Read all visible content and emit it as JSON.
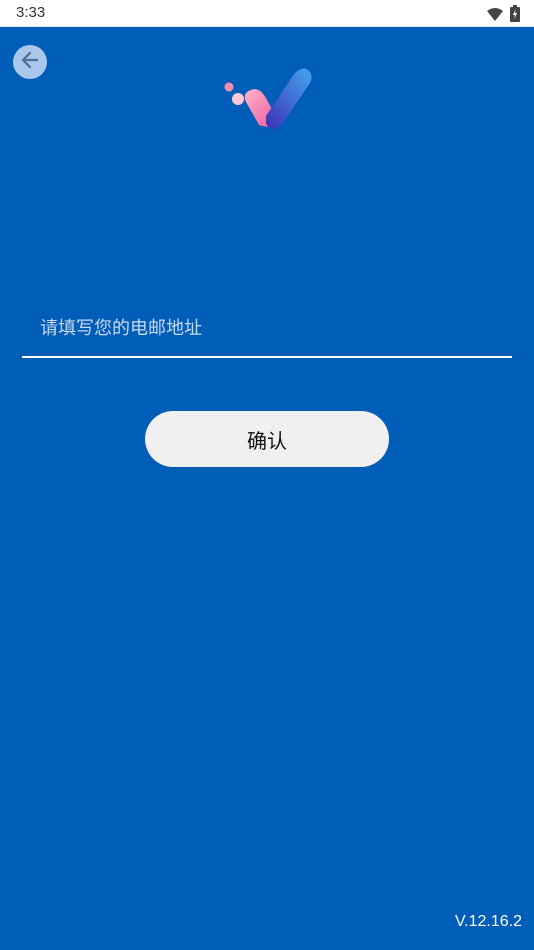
{
  "status_bar": {
    "time": "3:33"
  },
  "header": {
    "back_icon": "arrow-left-icon",
    "logo_icon": "app-logo-icon"
  },
  "form": {
    "email_placeholder": "请填写您的电邮地址",
    "email_value": "",
    "confirm_label": "确认"
  },
  "footer": {
    "version": "V.12.16.2"
  },
  "colors": {
    "background": "#005DB8",
    "button_bg": "#F0F0F0",
    "input_line": "#FFFFFF",
    "status_bar_bg": "#FFFFFF"
  }
}
